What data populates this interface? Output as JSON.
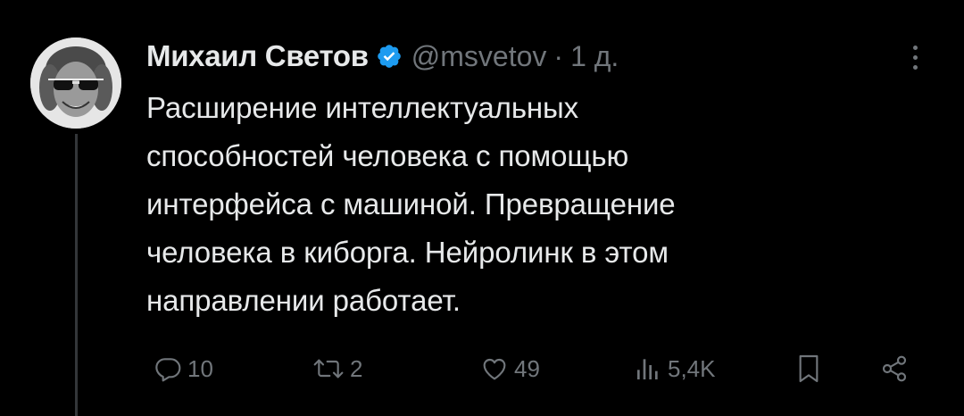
{
  "tweet": {
    "author": {
      "display_name": "Михаил Светов",
      "handle": "@msvetov",
      "verified": true,
      "avatar": "user-avatar-photo"
    },
    "separator": "·",
    "time": "1 д.",
    "text": "Расширение интеллектуальных\nспособностей человека с помощью\nинтерфейса с машиной. Превращение\nчеловека в киборга. Нейролинк в этом\nнаправлении работает."
  },
  "actions": {
    "reply": {
      "icon": "reply-icon",
      "count": "10"
    },
    "retweet": {
      "icon": "retweet-icon",
      "count": "2"
    },
    "like": {
      "icon": "heart-icon",
      "count": "49"
    },
    "views": {
      "icon": "views-icon",
      "count": "5,4K"
    },
    "bookmark": {
      "icon": "bookmark-icon"
    },
    "share": {
      "icon": "share-icon"
    }
  },
  "colors": {
    "background": "#000000",
    "text": "#e7e9ea",
    "muted": "#71767b",
    "verified_badge": "#1d9bf0",
    "thread_line": "#333639"
  }
}
